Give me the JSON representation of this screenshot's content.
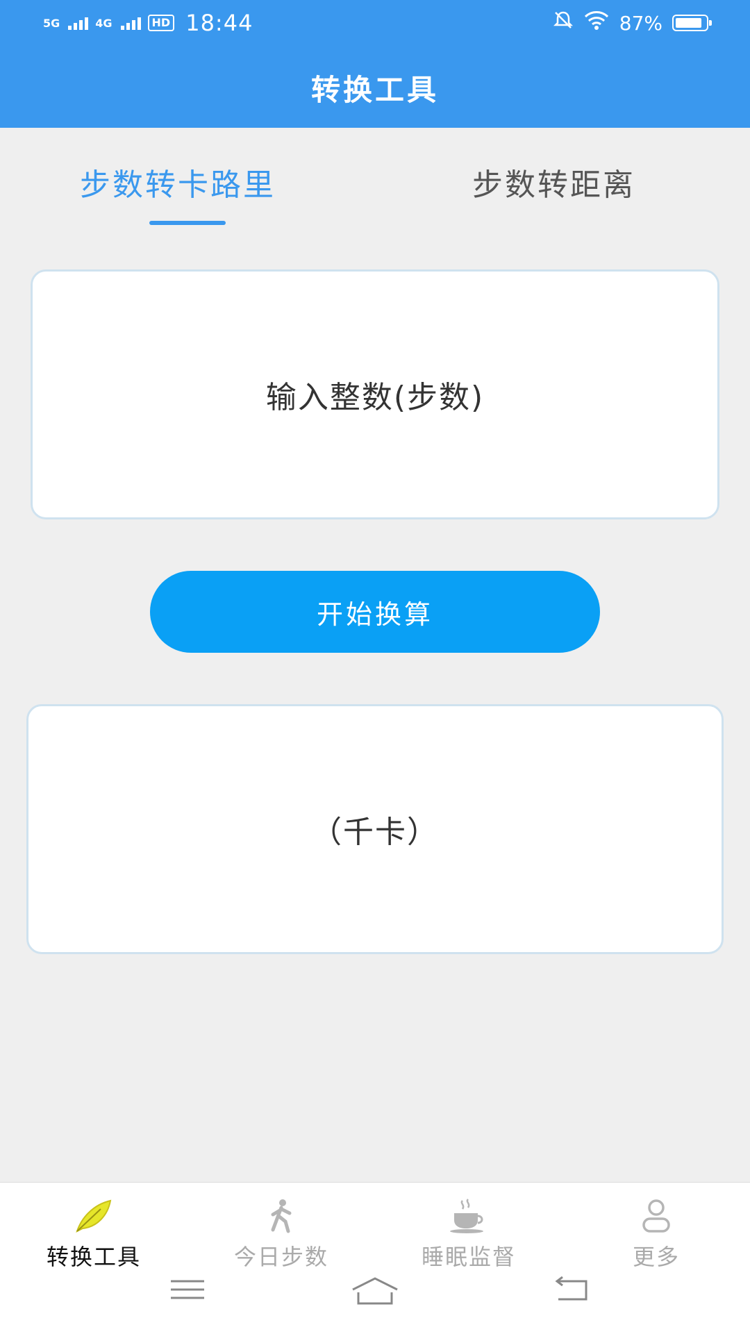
{
  "status_bar": {
    "network1": "5G",
    "network2": "4G",
    "hd": "HD",
    "time": "18:44",
    "battery": "87%",
    "battery_level": 0.87
  },
  "app_bar": {
    "title": "转换工具"
  },
  "tabs": [
    {
      "label": "步数转卡路里",
      "active": true
    },
    {
      "label": "步数转距离",
      "active": false
    }
  ],
  "input": {
    "placeholder": "输入整数(步数)"
  },
  "convert_button": {
    "label": "开始换算"
  },
  "result": {
    "text": "（千卡）"
  },
  "bottom_nav": [
    {
      "label": "转换工具",
      "icon": "feather-icon",
      "active": true
    },
    {
      "label": "今日步数",
      "icon": "walking-person-icon",
      "active": false
    },
    {
      "label": "睡眠监督",
      "icon": "coffee-cup-icon",
      "active": false
    },
    {
      "label": "更多",
      "icon": "person-icon",
      "active": false
    }
  ],
  "colors": {
    "primary": "#3a98ee",
    "button": "#0aa0f5",
    "active_nav_icon": "#e6e62a",
    "inactive": "#aaaaaa"
  }
}
